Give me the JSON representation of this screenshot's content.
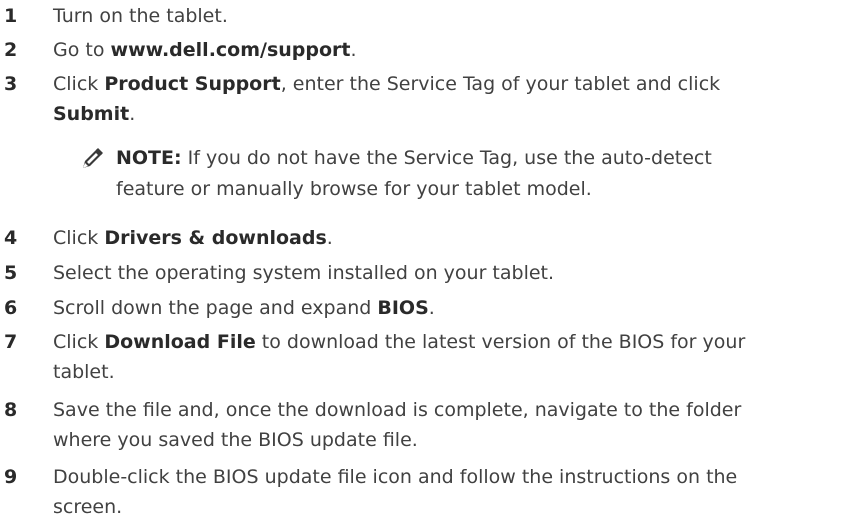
{
  "steps": [
    {
      "number": "1",
      "parts": [
        {
          "t": "Turn on the tablet.",
          "b": false
        }
      ]
    },
    {
      "number": "2",
      "parts": [
        {
          "t": "Go to ",
          "b": false
        },
        {
          "t": "www.dell.com/support",
          "b": true
        },
        {
          "t": ".",
          "b": false
        }
      ]
    },
    {
      "number": "3",
      "parts": [
        {
          "t": "Click ",
          "b": false
        },
        {
          "t": "Product Support",
          "b": true
        },
        {
          "t": ", enter the Service Tag of your tablet and click",
          "b": false
        }
      ],
      "parts2": [
        {
          "t": "Submit",
          "b": true
        },
        {
          "t": ".",
          "b": false
        }
      ]
    },
    {
      "number": "4",
      "parts": [
        {
          "t": "Click ",
          "b": false
        },
        {
          "t": "Drivers & downloads",
          "b": true
        },
        {
          "t": ".",
          "b": false
        }
      ]
    },
    {
      "number": "5",
      "parts": [
        {
          "t": "Select the operating system installed on your tablet.",
          "b": false
        }
      ]
    },
    {
      "number": "6",
      "parts": [
        {
          "t": "Scroll down the page and expand ",
          "b": false
        },
        {
          "t": "BIOS",
          "b": true
        },
        {
          "t": ".",
          "b": false
        }
      ]
    },
    {
      "number": "7",
      "parts": [
        {
          "t": "Click ",
          "b": false
        },
        {
          "t": "Download File",
          "b": true
        },
        {
          "t": " to download the latest version of the BIOS for your",
          "b": false
        }
      ],
      "parts2": [
        {
          "t": "tablet.",
          "b": false
        }
      ]
    },
    {
      "number": "8",
      "parts": [
        {
          "t": "Save the file and, once the download is complete, navigate to the folder",
          "b": false
        }
      ],
      "parts2": [
        {
          "t": "where you saved the BIOS update file.",
          "b": false
        }
      ]
    },
    {
      "number": "9",
      "parts": [
        {
          "t": "Double-click the BIOS update file icon and follow the instructions on the",
          "b": false
        }
      ],
      "parts2": [
        {
          "t": "screen.",
          "b": false
        }
      ]
    }
  ],
  "note": {
    "label": "NOTE:",
    "line1": " If you do not have the Service Tag, use the auto-detect",
    "line2": "feature or manually browse for your tablet model.",
    "icon": "pencil-note-icon"
  }
}
